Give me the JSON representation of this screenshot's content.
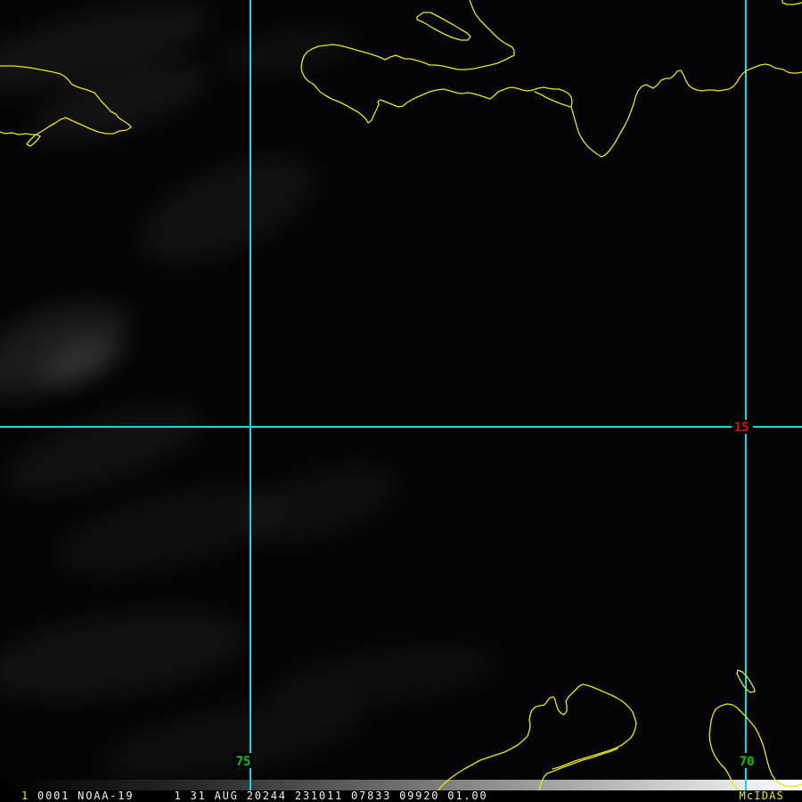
{
  "status_bar": {
    "frame_number": "1",
    "info": " 0001 NOAA-19     1 31 AUG 20244 231011 07833 09920 01.00",
    "brand": "McIDAS"
  },
  "grid_labels": {
    "latitude": "15",
    "longitude_west": "75",
    "longitude_east": "70"
  },
  "colors": {
    "coastline": "#e8e800",
    "grid_line": "#00e2e2",
    "latitude_label": "#dd1000",
    "longitude_label": "#00cc00",
    "status_text": "#f2f2f2",
    "frame_number": "#e8e800",
    "brand": "#e8e800"
  }
}
